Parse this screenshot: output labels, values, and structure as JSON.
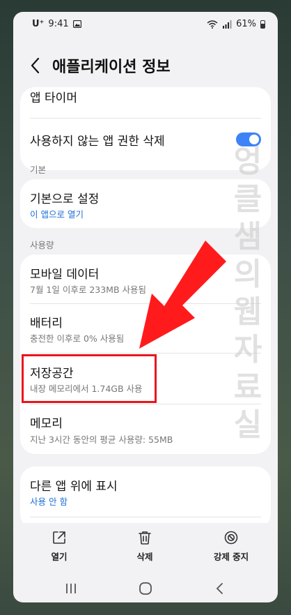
{
  "status": {
    "carrier": "U⁺",
    "time": "9:41",
    "battery": "61%"
  },
  "header": {
    "title": "애플리케이션 정보"
  },
  "card1": {
    "app_timer": "앱 타이머",
    "remove_permissions": "사용하지 않는 앱 권한 삭제",
    "remove_permissions_on": true
  },
  "sections": {
    "default": "기본",
    "usage": "사용량"
  },
  "defaults": {
    "title": "기본으로 설정",
    "sub": "이 앱으로 열기"
  },
  "usage": {
    "mobile_data_title": "모바일 데이터",
    "mobile_data_sub": "7월 1일 이후로 233MB 사용됨",
    "battery_title": "배터리",
    "battery_sub": "충전한 이후로 0% 사용됨",
    "storage_title": "저장공간",
    "storage_sub": "내장 메모리에서 1.74GB 사용",
    "memory_title": "메모리",
    "memory_sub": "지난 3시간 동안의 평균 사용량: 55MB"
  },
  "overlay": {
    "title": "다른 앱 위에 표시",
    "sub": "사용 안 함"
  },
  "actions": {
    "open": "열기",
    "delete": "삭제",
    "force_stop": "강제 중지"
  },
  "watermark": "엉클샘의웹자료실",
  "colors": {
    "accent_blue": "#3e82f7",
    "highlight_red": "#e8161d"
  }
}
